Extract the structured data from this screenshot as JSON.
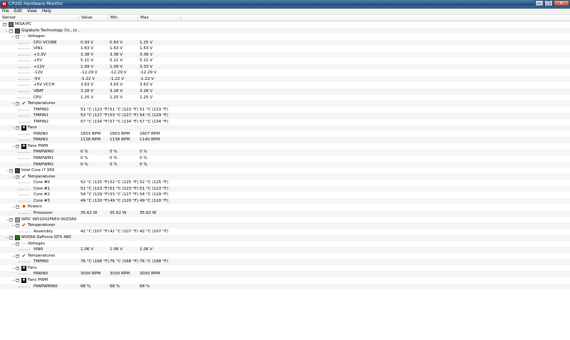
{
  "window": {
    "app_icon": "H",
    "title": "CPUID Hardware Monitor",
    "buttons": [
      "—",
      "❐",
      "✕"
    ]
  },
  "menu": [
    "File",
    "Edit",
    "View",
    "Help"
  ],
  "columns": [
    "Sensor",
    "Value",
    "Min",
    "Max"
  ],
  "icons": {
    "pc": "computer-icon",
    "board": "motherboard-icon",
    "cpu": "cpu-icon",
    "hdd": "hard-drive-icon",
    "gpu": "graphics-card-icon",
    "volt": "voltage-icon",
    "temp": "thermometer-icon",
    "fan": "fan-icon",
    "power": "power-icon"
  },
  "rows": [
    {
      "level": 0,
      "kind": "node",
      "icon": "pc",
      "label": "MISA-PC"
    },
    {
      "level": 1,
      "kind": "node",
      "icon": "board",
      "label": "Gigabyte Technology Co., Lt..."
    },
    {
      "level": 2,
      "kind": "node",
      "icon": "volt",
      "label": "Voltages"
    },
    {
      "level": 3,
      "kind": "leaf",
      "label": "CPU VCORE",
      "value": "0.93 V",
      "min": "0.93 V",
      "max": "1.25 V"
    },
    {
      "level": 3,
      "kind": "leaf",
      "label": "VIN1",
      "value": "1.63 V",
      "min": "1.63 V",
      "max": "1.63 V"
    },
    {
      "level": 3,
      "kind": "leaf",
      "label": "+3.3V",
      "value": "3.38 V",
      "min": "3.38 V",
      "max": "3.38 V"
    },
    {
      "level": 3,
      "kind": "leaf",
      "label": "+5V",
      "value": "5.11 V",
      "min": "5.11 V",
      "max": "5.11 V"
    },
    {
      "level": 3,
      "kind": "leaf",
      "label": "+12V",
      "value": "1.09 V",
      "min": "1.09 V",
      "max": "3.33 V"
    },
    {
      "level": 3,
      "kind": "leaf",
      "label": "-12V",
      "value": "-12.29 V",
      "min": "-12.29 V",
      "max": "-12.29 V"
    },
    {
      "level": 3,
      "kind": "leaf",
      "label": "-5V",
      "value": "-1.22 V",
      "min": "-1.22 V",
      "max": "-1.22 V"
    },
    {
      "level": 3,
      "kind": "leaf",
      "label": "+5V VCCH",
      "value": "3.63 V",
      "min": "3.63 V",
      "max": "3.63 V"
    },
    {
      "level": 3,
      "kind": "leaf",
      "label": "VBAT",
      "value": "3.28 V",
      "min": "3.28 V",
      "max": "3.28 V"
    },
    {
      "level": 3,
      "kind": "leaf",
      "label": "CPU",
      "value": "1.25 V",
      "min": "1.25 V",
      "max": "1.25 V"
    },
    {
      "level": 2,
      "kind": "node",
      "icon": "temp",
      "label": "Temperatures"
    },
    {
      "level": 3,
      "kind": "leaf",
      "label": "TMPIN0",
      "value": "51 °C  (123 °F)",
      "min": "51 °C  (123 °F)",
      "max": "51 °C  (123 °F)"
    },
    {
      "level": 3,
      "kind": "leaf",
      "label": "TMPIN1",
      "value": "53 °C  (127 °F)",
      "min": "53 °C  (127 °F)",
      "max": "54 °C  (129 °F)"
    },
    {
      "level": 3,
      "kind": "leaf",
      "label": "TMPIN2",
      "value": "57 °C  (134 °F)",
      "min": "57 °C  (134 °F)",
      "max": "57 °C  (134 °F)"
    },
    {
      "level": 2,
      "kind": "node",
      "icon": "fan",
      "label": "Fans"
    },
    {
      "level": 3,
      "kind": "leaf",
      "label": "FANIN0",
      "value": "1603 RPM",
      "min": "1603 RPM",
      "max": "1607 RPM"
    },
    {
      "level": 3,
      "kind": "leaf",
      "label": "FANIN3",
      "value": "1138 RPM",
      "min": "1138 RPM",
      "max": "1140 RPM"
    },
    {
      "level": 2,
      "kind": "node",
      "icon": "fan",
      "label": "Fans PWM"
    },
    {
      "level": 3,
      "kind": "leaf",
      "label": "FANPWM0",
      "value": "0 %",
      "min": "0 %",
      "max": "0 %"
    },
    {
      "level": 3,
      "kind": "leaf",
      "label": "FANPWM1",
      "value": "0 %",
      "min": "0 %",
      "max": "0 %"
    },
    {
      "level": 3,
      "kind": "leaf",
      "label": "FANPWM2",
      "value": "0 %",
      "min": "0 %",
      "max": "0 %"
    },
    {
      "level": 1,
      "kind": "node",
      "icon": "cpu",
      "label": "Intel Core i7 950"
    },
    {
      "level": 2,
      "kind": "node",
      "icon": "temp",
      "label": "Temperatures"
    },
    {
      "level": 3,
      "kind": "leaf",
      "label": "Core #0",
      "value": "52 °C  (125 °F)",
      "min": "52 °C  (125 °F)",
      "max": "52 °C  (125 °F)"
    },
    {
      "level": 3,
      "kind": "leaf",
      "label": "Core #1",
      "value": "51 °C  (123 °F)",
      "min": "51 °C  (123 °F)",
      "max": "51 °C  (123 °F)"
    },
    {
      "level": 3,
      "kind": "leaf",
      "label": "Core #2",
      "value": "54 °C  (129 °F)",
      "min": "53 °C  (127 °F)",
      "max": "54 °C  (129 °F)"
    },
    {
      "level": 3,
      "kind": "leaf",
      "label": "Core #3",
      "value": "49 °C  (120 °F)",
      "min": "49 °C  (120 °F)",
      "max": "49 °C  (120 °F)"
    },
    {
      "level": 2,
      "kind": "node",
      "icon": "power",
      "label": "Powers"
    },
    {
      "level": 3,
      "kind": "leaf",
      "label": "Processor",
      "value": "35.62 W",
      "min": "35.62 W",
      "max": "35.62 W"
    },
    {
      "level": 1,
      "kind": "node",
      "icon": "hdd",
      "label": "WDC WD1002FAEX-00Z3A0"
    },
    {
      "level": 2,
      "kind": "node",
      "icon": "temp",
      "label": "Temperatures"
    },
    {
      "level": 3,
      "kind": "leaf",
      "label": "Assembly",
      "value": "42 °C  (107 °F)",
      "min": "42 °C  (107 °F)",
      "max": "42 °C  (107 °F)"
    },
    {
      "level": 1,
      "kind": "node",
      "icon": "gpu",
      "label": "NVIDIA GeForce GTX 480"
    },
    {
      "level": 2,
      "kind": "node",
      "icon": "volt",
      "label": "Voltages"
    },
    {
      "level": 3,
      "kind": "leaf",
      "label": "VIN0",
      "value": "1.06 V",
      "min": "1.06 V",
      "max": "1.06 V"
    },
    {
      "level": 2,
      "kind": "node",
      "icon": "temp",
      "label": "Temperatures"
    },
    {
      "level": 3,
      "kind": "leaf",
      "label": "TMPIN0",
      "value": "76 °C  (168 °F)",
      "min": "76 °C  (168 °F)",
      "max": "76 °C  (168 °F)"
    },
    {
      "level": 2,
      "kind": "node",
      "icon": "fan",
      "label": "Fans"
    },
    {
      "level": 3,
      "kind": "leaf",
      "label": "FANIN0",
      "value": "3030 RPM",
      "min": "3030 RPM",
      "max": "3030 RPM"
    },
    {
      "level": 2,
      "kind": "node",
      "icon": "fan",
      "label": "Fans PWM"
    },
    {
      "level": 3,
      "kind": "leaf",
      "label": "FANPWMIN0",
      "value": "68 %",
      "min": "68 %",
      "max": "68 %"
    }
  ]
}
